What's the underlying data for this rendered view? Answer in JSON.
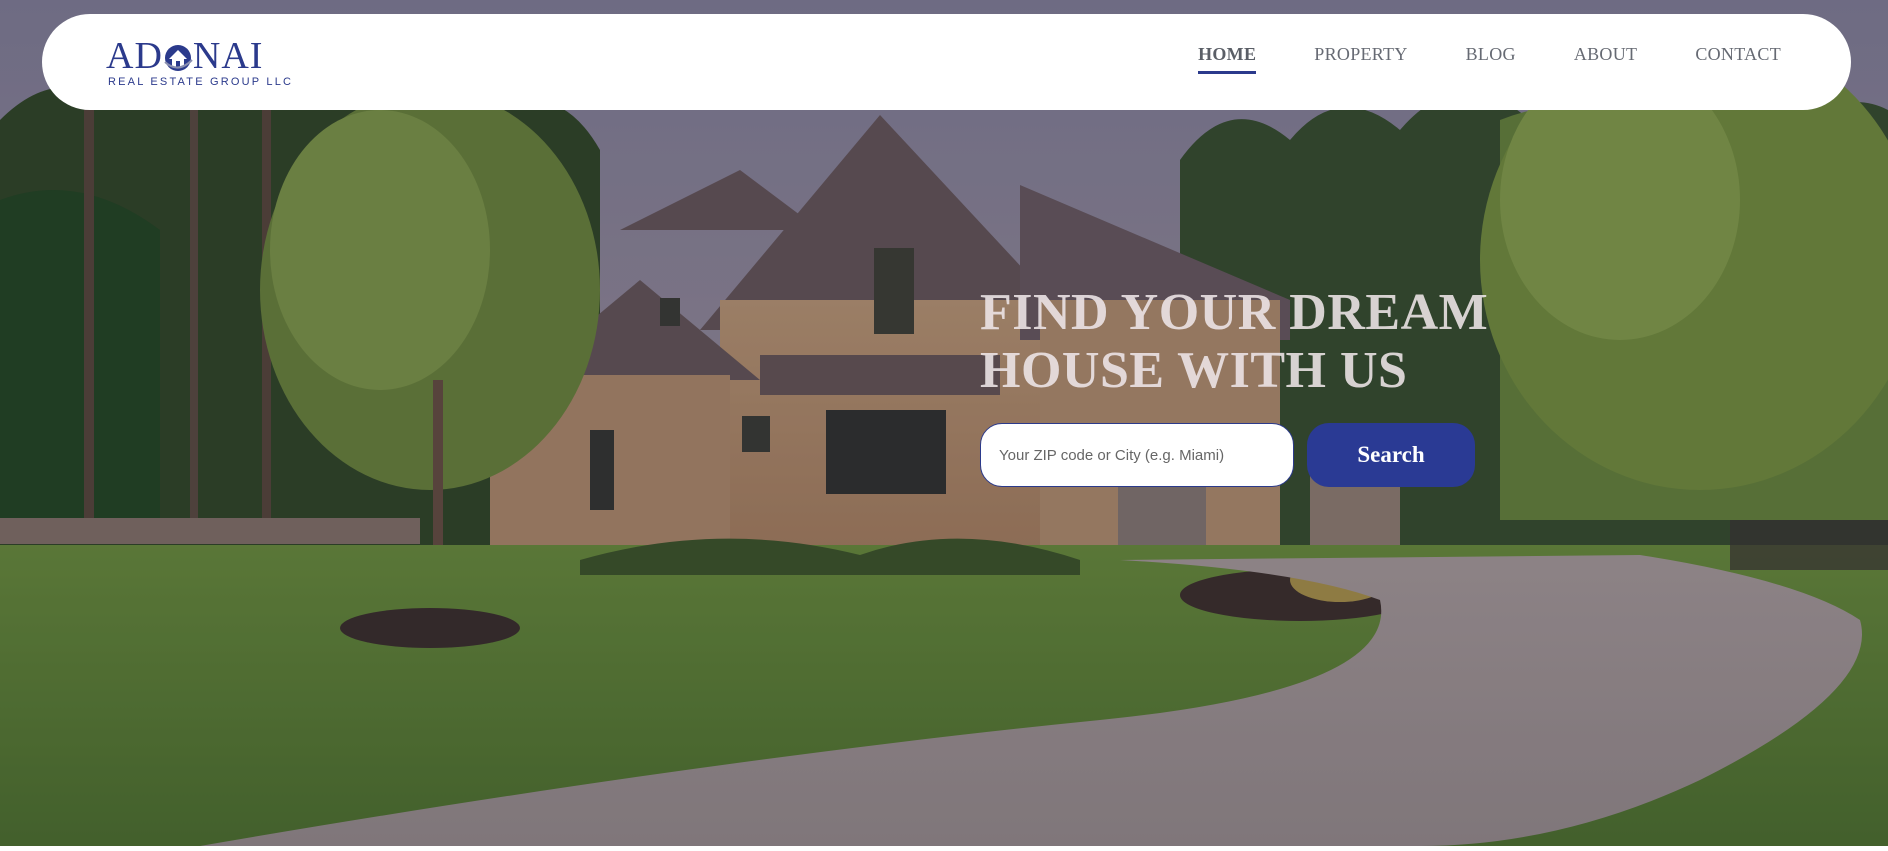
{
  "brand": {
    "name_left": "AD",
    "name_right": "NAI",
    "tagline": "REAL ESTATE GROUP LLC",
    "color": "#2b3a8c"
  },
  "nav": {
    "items": [
      {
        "label": "HOME",
        "active": true
      },
      {
        "label": "PROPERTY",
        "active": false
      },
      {
        "label": "BLOG",
        "active": false
      },
      {
        "label": "ABOUT",
        "active": false
      },
      {
        "label": "CONTACT",
        "active": false
      }
    ]
  },
  "hero": {
    "headline": "FIND YOUR DREAM HOUSE WITH US",
    "search": {
      "placeholder": "Your ZIP code or City (e.g. Miami)",
      "value": "",
      "button_label": "Search"
    }
  },
  "colors": {
    "accent": "#2a3a94",
    "nav_text": "#666a73"
  }
}
